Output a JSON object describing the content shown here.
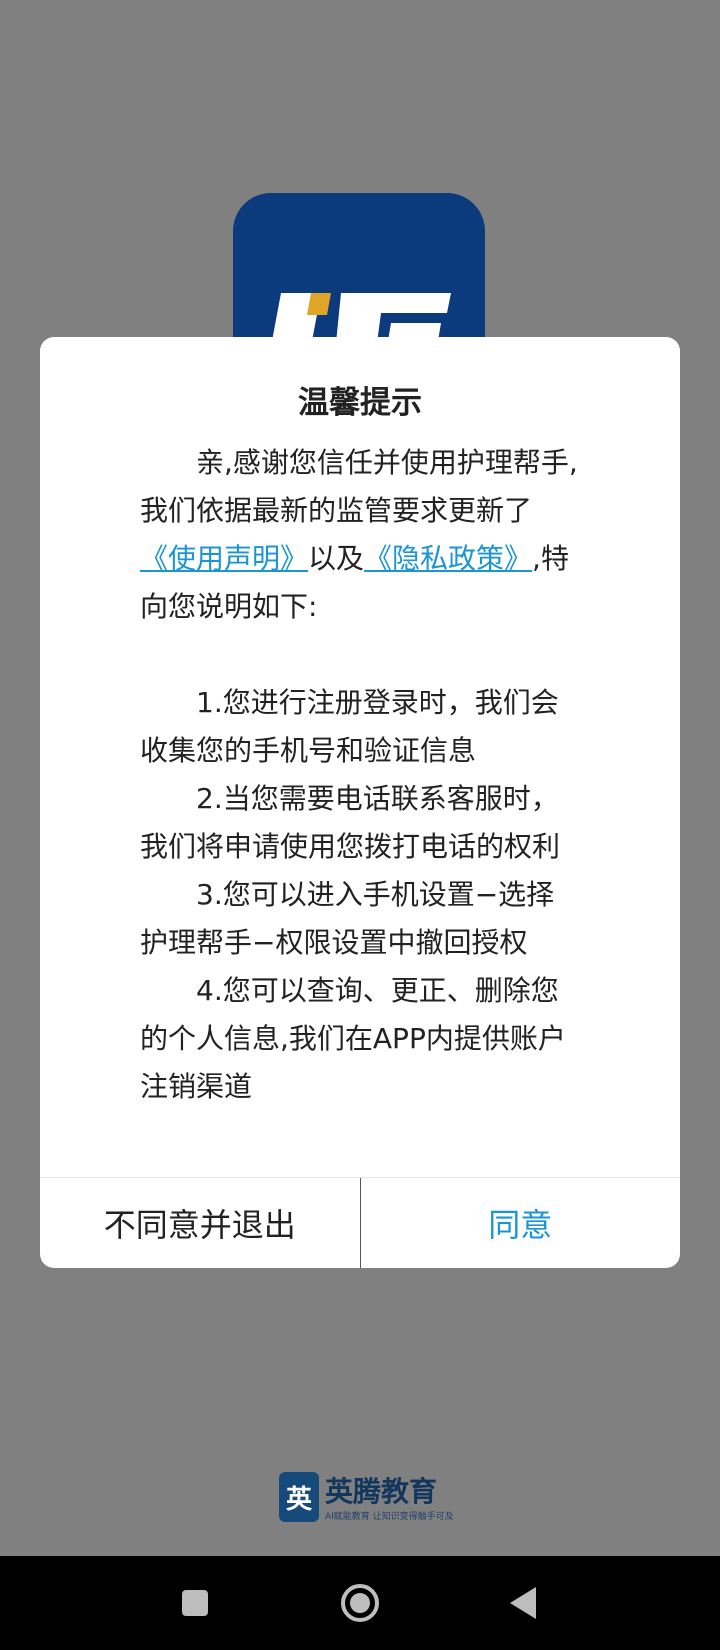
{
  "background_app": {
    "icon_name": "app-launcher-icon",
    "icon_color": "#0b3a7d"
  },
  "dialog": {
    "title": "温馨提示",
    "intro_prefix": "亲,感谢您信任并使用护理帮手,我们依据最新的监管要求更新了",
    "link_terms": "《使用声明》",
    "intro_mid": "以及",
    "link_privacy": "《隐私政策》",
    "intro_suffix": ",特向您说明如下:",
    "items": [
      "1.您进行注册登录时，我们会收集您的手机号和验证信息",
      "2.当您需要电话联系客服时，我们将申请使用您拨打电话的权利",
      "3.您可以进入手机设置−选择护理帮手−权限设置中撤回授权",
      "4.您可以查询、更正、删除您的个人信息,我们在APP内提供账户注销渠道"
    ],
    "disagree_label": "不同意并退出",
    "agree_label": "同意",
    "link_color": "#1b95d4"
  },
  "brand": {
    "logo_char": "英",
    "name": "英腾教育",
    "tagline": "AI赋能教育 让知识变得触手可及"
  },
  "navbar": {
    "recent_icon": "recent-apps-icon",
    "home_icon": "home-icon",
    "back_icon": "back-icon"
  }
}
